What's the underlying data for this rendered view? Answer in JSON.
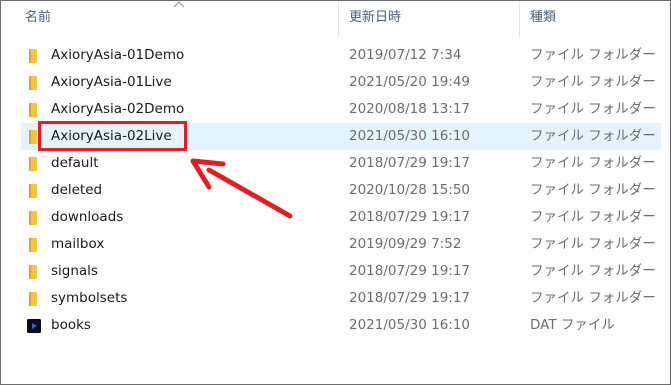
{
  "header": {
    "name_col": "名前",
    "date_col": "更新日時",
    "type_col": "種類"
  },
  "colors": {
    "folder": "#f5c542",
    "folder_dark": "#dba92a",
    "selected_row": "#e5f3ff",
    "annotation": "#e31e24"
  },
  "files": [
    {
      "name": "AxioryAsia-01Demo",
      "modified": "2019/07/12 7:34",
      "type": "ファイル フォルダー",
      "icon": "folder-icon"
    },
    {
      "name": "AxioryAsia-01Live",
      "modified": "2021/05/20 19:49",
      "type": "ファイル フォルダー",
      "icon": "folder-icon"
    },
    {
      "name": "AxioryAsia-02Demo",
      "modified": "2020/08/18 13:17",
      "type": "ファイル フォルダー",
      "icon": "folder-icon"
    },
    {
      "name": "AxioryAsia-02Live",
      "modified": "2021/05/30 16:10",
      "type": "ファイル フォルダー",
      "icon": "folder-icon",
      "selected": true
    },
    {
      "name": "default",
      "modified": "2018/07/29 19:17",
      "type": "ファイル フォルダー",
      "icon": "folder-icon"
    },
    {
      "name": "deleted",
      "modified": "2020/10/28 15:50",
      "type": "ファイル フォルダー",
      "icon": "folder-icon"
    },
    {
      "name": "downloads",
      "modified": "2018/07/29 19:17",
      "type": "ファイル フォルダー",
      "icon": "folder-icon"
    },
    {
      "name": "mailbox",
      "modified": "2019/09/29 7:52",
      "type": "ファイル フォルダー",
      "icon": "folder-icon"
    },
    {
      "name": "signals",
      "modified": "2018/07/29 19:17",
      "type": "ファイル フォルダー",
      "icon": "folder-icon"
    },
    {
      "name": "symbolsets",
      "modified": "2018/07/29 19:17",
      "type": "ファイル フォルダー",
      "icon": "folder-icon"
    },
    {
      "name": "books",
      "modified": "2021/05/30 16:10",
      "type": "DAT ファイル",
      "icon": "dat-file-icon"
    }
  ]
}
